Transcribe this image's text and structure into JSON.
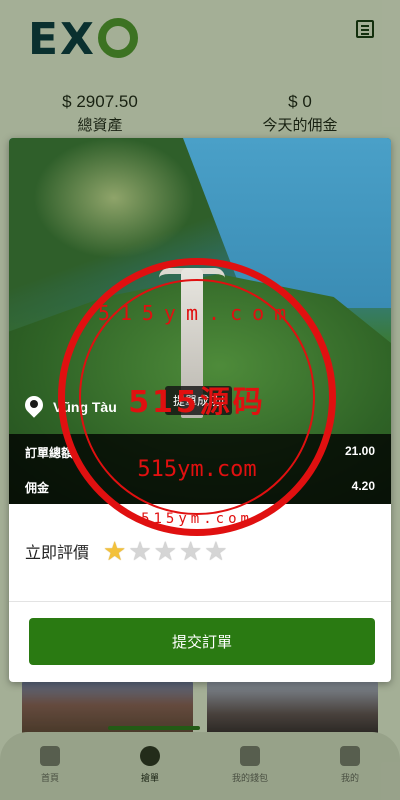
{
  "header": {
    "logo_text": "EXO",
    "menu_icon": "list-icon"
  },
  "stats": {
    "total_assets_value": "$ 2907.50",
    "total_assets_label": "總資產",
    "today_commission_value": "$ 0",
    "today_commission_label": "今天的佣金"
  },
  "modal": {
    "location": "Vũng Tàu",
    "location_icon": "map-pin-icon",
    "toast": "提單成功!",
    "order_total_label": "訂單總額",
    "order_total_value": "21.00",
    "commission_label": "佣金",
    "commission_value": "4.20",
    "rate_label": "立即評價",
    "rating": 1,
    "rating_max": 5,
    "submit_label": "提交訂單",
    "submit_color": "#2a7a12"
  },
  "watermark": {
    "top": "515ym.com",
    "center": "515源码",
    "url": "515ym.com",
    "bottom": "515ym.com"
  },
  "bottom_nav": {
    "items": [
      {
        "label": "首頁",
        "icon": "home-icon"
      },
      {
        "label": "搶單",
        "icon": "grab-order-icon"
      },
      {
        "label": "我的錢包",
        "icon": "wallet-icon"
      },
      {
        "label": "我的",
        "icon": "user-icon"
      }
    ],
    "active_index": 1
  }
}
